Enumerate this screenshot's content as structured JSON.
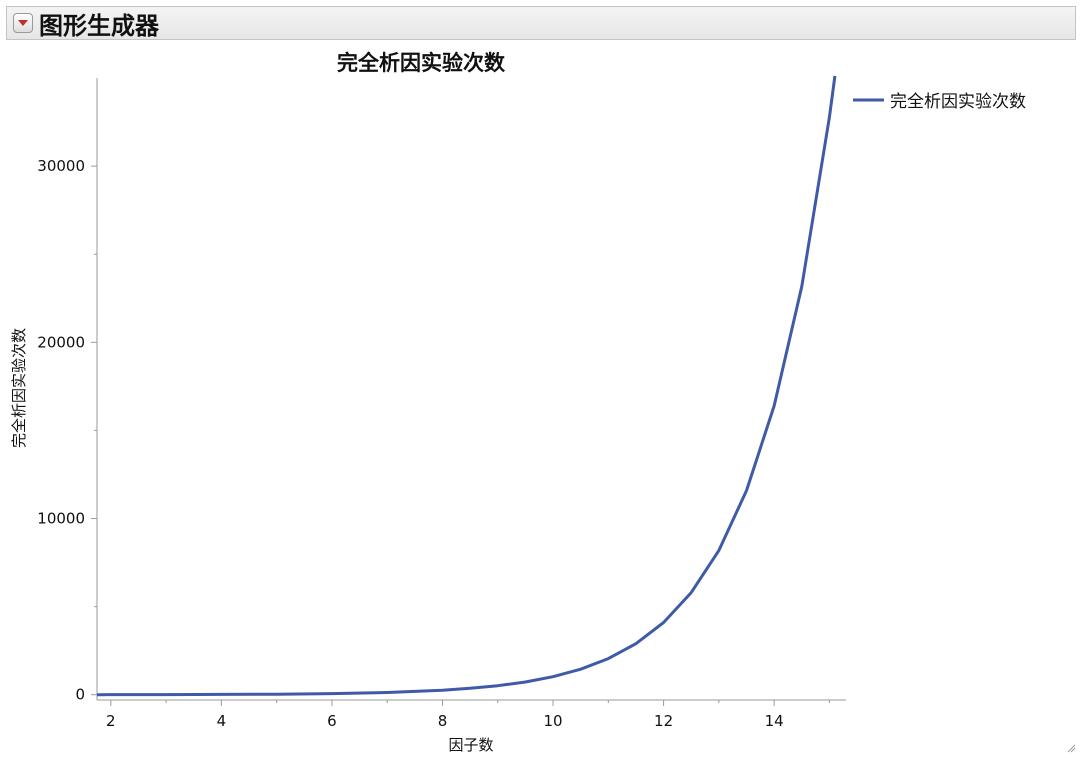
{
  "header": {
    "title": "图形生成器",
    "disclosure_icon": "red-triangle-down-icon"
  },
  "colors": {
    "series": "#3f5aa6",
    "disclosure": "#c0302b",
    "axis": "#9a9a9a"
  },
  "chart_data": {
    "type": "line",
    "title": "完全析因实验次数",
    "xlabel": "因子数",
    "ylabel": "完全析因实验次数",
    "xlim": [
      1.75,
      15.3
    ],
    "ylim": [
      -300,
      35000
    ],
    "xticks": [
      "2",
      "4",
      "6",
      "8",
      "10",
      "12",
      "14"
    ],
    "yticks": [
      "0",
      "10000",
      "20000",
      "30000"
    ],
    "grid": false,
    "legend": "right",
    "series": [
      {
        "name": "完全析因实验次数",
        "x": [
          1.75,
          2,
          3,
          4,
          5,
          6,
          7,
          8,
          8.5,
          9,
          9.5,
          10,
          10.5,
          11,
          11.5,
          12,
          12.5,
          13,
          13.5,
          14,
          14.5,
          15,
          15.1
        ],
        "y": [
          3,
          4,
          8,
          16,
          32,
          64,
          128,
          256,
          362,
          512,
          724,
          1024,
          1448,
          2048,
          2896,
          4096,
          5793,
          8192,
          11585,
          16384,
          23170,
          32768,
          35120
        ]
      }
    ]
  }
}
